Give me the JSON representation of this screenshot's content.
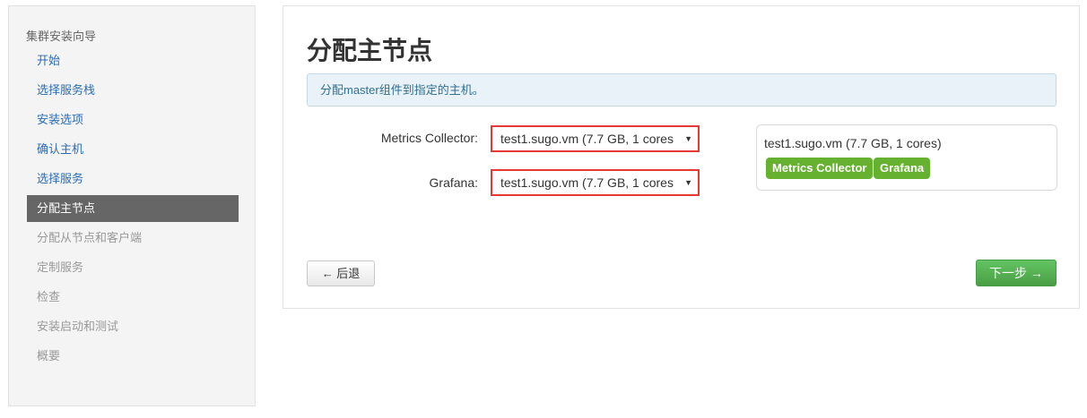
{
  "sidebar": {
    "header": "集群安装向导",
    "items": [
      {
        "label": "开始",
        "state": "done"
      },
      {
        "label": "选择服务栈",
        "state": "done"
      },
      {
        "label": "安装选项",
        "state": "done"
      },
      {
        "label": "确认主机",
        "state": "done"
      },
      {
        "label": "选择服务",
        "state": "done"
      },
      {
        "label": "分配主节点",
        "state": "active"
      },
      {
        "label": "分配从节点和客户端",
        "state": "pending"
      },
      {
        "label": "定制服务",
        "state": "pending"
      },
      {
        "label": "检查",
        "state": "pending"
      },
      {
        "label": "安装启动和测试",
        "state": "pending"
      },
      {
        "label": "概要",
        "state": "pending"
      }
    ]
  },
  "main": {
    "title": "分配主节点",
    "alert": "分配master组件到指定的主机。",
    "assignments": [
      {
        "label": "Metrics Collector:",
        "selected": "test1.sugo.vm (7.7 GB, 1 cores"
      },
      {
        "label": "Grafana:",
        "selected": "test1.sugo.vm (7.7 GB, 1 cores"
      }
    ],
    "host_summary": {
      "host": "test1.sugo.vm (7.7 GB, 1 cores)",
      "components": [
        "Metrics Collector",
        "Grafana"
      ]
    },
    "back_button": "← 后退",
    "next_button": "下一步 →"
  },
  "colors": {
    "link": "#2a6db5",
    "active_bg": "#666666",
    "alert_bg": "#e9f2f8",
    "highlight_border": "#e53935",
    "tag_green": "#67b130",
    "primary_button": "#5cb85c"
  },
  "icons": {
    "select_caret": "▼"
  }
}
